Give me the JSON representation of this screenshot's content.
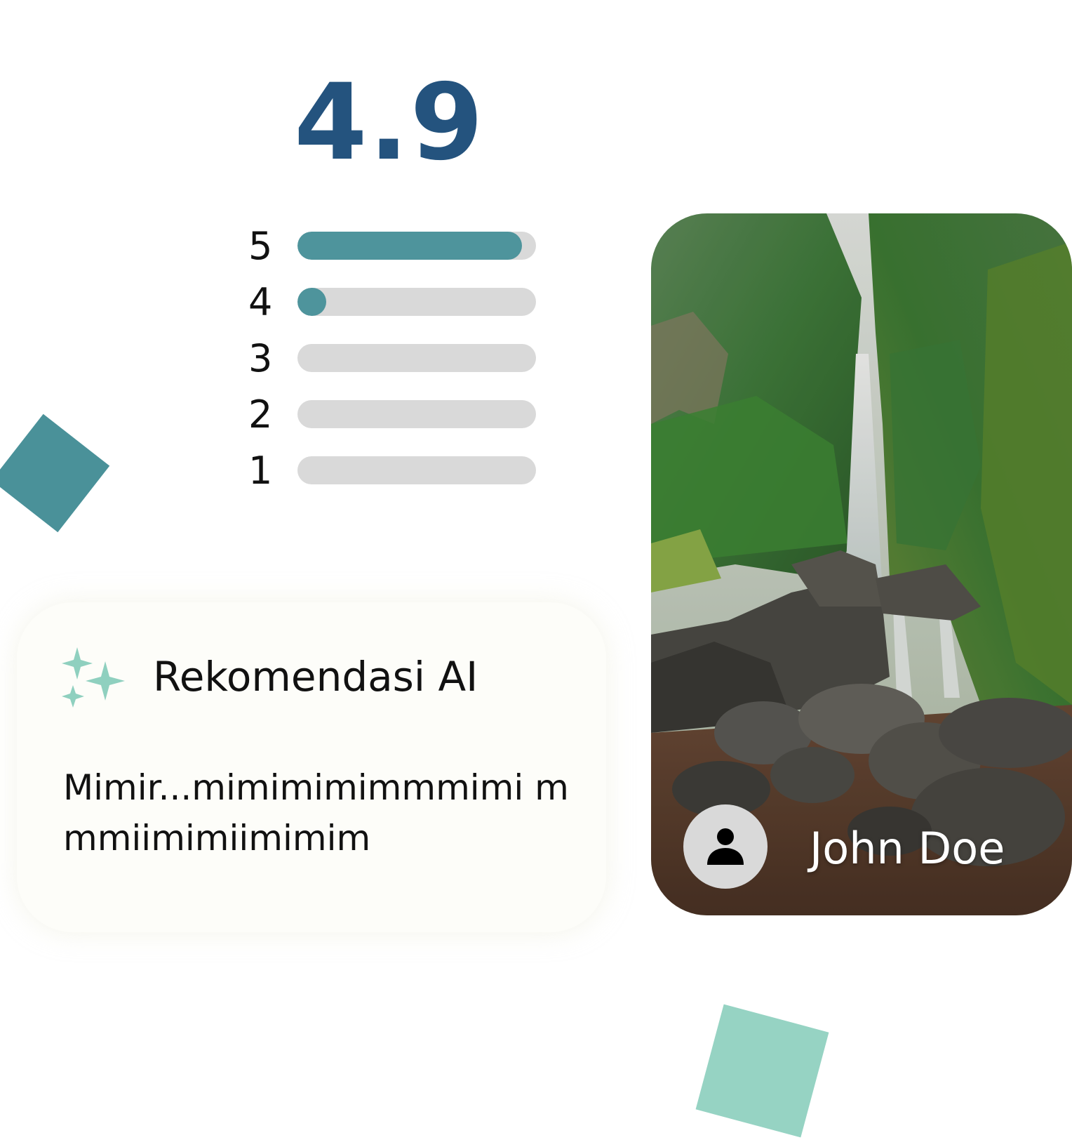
{
  "rating": {
    "score": "4.9",
    "bars": [
      {
        "label": "5",
        "fraction": 0.94
      },
      {
        "label": "4",
        "fraction": 0.12
      },
      {
        "label": "3",
        "fraction": 0
      },
      {
        "label": "2",
        "fraction": 0
      },
      {
        "label": "1",
        "fraction": 0
      }
    ]
  },
  "ai_card": {
    "icon": "sparkles-icon",
    "title": "Rekomendasi AI",
    "text": "Mimir...mimimimimmmimi mmmiimimiimimim"
  },
  "photo_card": {
    "image": "waterfall-photo",
    "avatar_icon": "user-icon",
    "user_name": "John Doe"
  },
  "colors": {
    "score": "#24537e",
    "bar_fill": "#4e949c",
    "bar_track": "#d9d9d9",
    "diamond_left": "#4a9199",
    "diamond_bottom": "#96d3c3",
    "sparkle": "#8fd0bf"
  }
}
